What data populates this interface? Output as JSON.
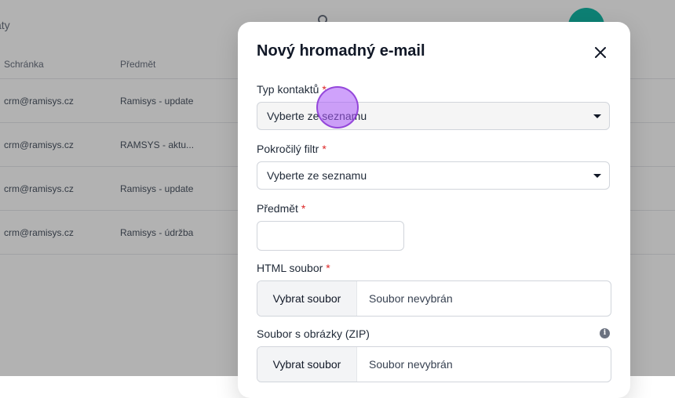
{
  "background": {
    "title": "aty",
    "columns": [
      "Schránka",
      "Předmět",
      ""
    ],
    "rows": [
      [
        "crm@ramisys.cz",
        "Ramisys - update",
        ""
      ],
      [
        "crm@ramisys.cz",
        "RAMSYS - aktu...",
        ""
      ],
      [
        "crm@ramisys.cz",
        "Ramisys - update",
        ""
      ],
      [
        "crm@ramisys.cz",
        "Ramisys - údržba",
        ""
      ]
    ]
  },
  "modal": {
    "title": "Nový hromadný e-mail",
    "required_mark": "*",
    "fields": {
      "contact_type": {
        "label": "Typ kontaktů",
        "value": "Vyberte ze seznamu"
      },
      "advanced_filter": {
        "label": "Pokročilý filtr",
        "value": "Vyberte ze seznamu"
      },
      "subject": {
        "label": "Předmět",
        "value": ""
      },
      "html_file": {
        "label": "HTML soubor",
        "button": "Vybrat soubor",
        "status": "Soubor nevybrán"
      },
      "images_zip": {
        "label": "Soubor s obrázky (ZIP)",
        "button": "Vybrat soubor",
        "status": "Soubor nevybrán"
      }
    }
  },
  "colors": {
    "accent_required": "#dc2626",
    "avatar": "#14b8a6",
    "cursor_highlight": "#a855f7"
  },
  "icons": [
    "search-icon",
    "close-icon",
    "chevron-down-icon",
    "info-icon",
    "avatar"
  ]
}
